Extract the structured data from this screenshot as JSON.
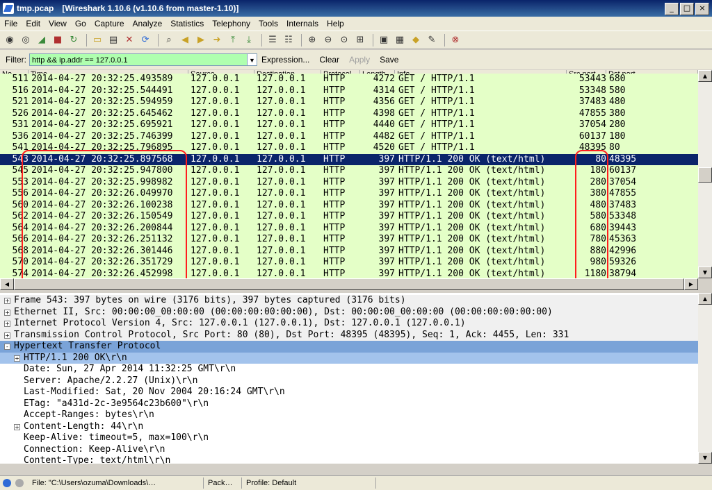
{
  "window": {
    "file": "tmp.pcap",
    "title": "[Wireshark 1.10.6  (v1.10.6 from master-1.10)]"
  },
  "menu": [
    "File",
    "Edit",
    "View",
    "Go",
    "Capture",
    "Analyze",
    "Statistics",
    "Telephony",
    "Tools",
    "Internals",
    "Help"
  ],
  "toolbar_icons": [
    "interface-list-icon",
    "capture-options-icon",
    "start-capture-icon",
    "stop-capture-icon",
    "restart-capture-icon",
    "open-file-icon",
    "save-file-icon",
    "close-file-icon",
    "reload-icon",
    "find-packet-icon",
    "go-back-icon",
    "go-forward-icon",
    "go-to-packet-icon",
    "go-first-icon",
    "go-last-icon",
    "colorize-icon",
    "autoscroll-icon",
    "zoom-in-icon",
    "zoom-out-icon",
    "normal-size-icon",
    "resize-columns-icon",
    "capture-filters-icon",
    "display-filters-icon",
    "coloring-rules-icon",
    "preferences-icon",
    "help-icon"
  ],
  "filter": {
    "label": "Filter:",
    "value": "http && ip.addr == 127.0.0.1",
    "expression": "Expression...",
    "clear": "Clear",
    "apply": "Apply",
    "save": "Save"
  },
  "columns": [
    "No.",
    "Time",
    "Source",
    "Destination",
    "Protocol",
    "Length",
    "Info",
    "Src port",
    "Dst port"
  ],
  "packets": [
    {
      "no": "511",
      "time": "2014-04-27 20:32:25.493589",
      "src": "127.0.0.1",
      "dst": "127.0.0.1",
      "proto": "HTTP",
      "len": "4272",
      "info": "GET / HTTP/1.1",
      "sport": "53443",
      "dport": "680"
    },
    {
      "no": "516",
      "time": "2014-04-27 20:32:25.544491",
      "src": "127.0.0.1",
      "dst": "127.0.0.1",
      "proto": "HTTP",
      "len": "4314",
      "info": "GET / HTTP/1.1",
      "sport": "53348",
      "dport": "580"
    },
    {
      "no": "521",
      "time": "2014-04-27 20:32:25.594959",
      "src": "127.0.0.1",
      "dst": "127.0.0.1",
      "proto": "HTTP",
      "len": "4356",
      "info": "GET / HTTP/1.1",
      "sport": "37483",
      "dport": "480"
    },
    {
      "no": "526",
      "time": "2014-04-27 20:32:25.645462",
      "src": "127.0.0.1",
      "dst": "127.0.0.1",
      "proto": "HTTP",
      "len": "4398",
      "info": "GET / HTTP/1.1",
      "sport": "47855",
      "dport": "380"
    },
    {
      "no": "531",
      "time": "2014-04-27 20:32:25.695921",
      "src": "127.0.0.1",
      "dst": "127.0.0.1",
      "proto": "HTTP",
      "len": "4440",
      "info": "GET / HTTP/1.1",
      "sport": "37054",
      "dport": "280"
    },
    {
      "no": "536",
      "time": "2014-04-27 20:32:25.746399",
      "src": "127.0.0.1",
      "dst": "127.0.0.1",
      "proto": "HTTP",
      "len": "4482",
      "info": "GET / HTTP/1.1",
      "sport": "60137",
      "dport": "180"
    },
    {
      "no": "541",
      "time": "2014-04-27 20:32:25.796895",
      "src": "127.0.0.1",
      "dst": "127.0.0.1",
      "proto": "HTTP",
      "len": "4520",
      "info": "GET / HTTP/1.1",
      "sport": "48395",
      "dport": "80"
    },
    {
      "no": "543",
      "time": "2014-04-27 20:32:25.897568",
      "src": "127.0.0.1",
      "dst": "127.0.0.1",
      "proto": "HTTP",
      "len": "397",
      "info": "HTTP/1.1 200 OK  (text/html)",
      "sport": "80",
      "dport": "48395"
    },
    {
      "no": "545",
      "time": "2014-04-27 20:32:25.947800",
      "src": "127.0.0.1",
      "dst": "127.0.0.1",
      "proto": "HTTP",
      "len": "397",
      "info": "HTTP/1.1 200 OK  (text/html)",
      "sport": "180",
      "dport": "60137"
    },
    {
      "no": "553",
      "time": "2014-04-27 20:32:25.998982",
      "src": "127.0.0.1",
      "dst": "127.0.0.1",
      "proto": "HTTP",
      "len": "397",
      "info": "HTTP/1.1 200 OK  (text/html)",
      "sport": "280",
      "dport": "37054"
    },
    {
      "no": "556",
      "time": "2014-04-27 20:32:26.049970",
      "src": "127.0.0.1",
      "dst": "127.0.0.1",
      "proto": "HTTP",
      "len": "397",
      "info": "HTTP/1.1 200 OK  (text/html)",
      "sport": "380",
      "dport": "47855"
    },
    {
      "no": "560",
      "time": "2014-04-27 20:32:26.100238",
      "src": "127.0.0.1",
      "dst": "127.0.0.1",
      "proto": "HTTP",
      "len": "397",
      "info": "HTTP/1.1 200 OK  (text/html)",
      "sport": "480",
      "dport": "37483"
    },
    {
      "no": "562",
      "time": "2014-04-27 20:32:26.150549",
      "src": "127.0.0.1",
      "dst": "127.0.0.1",
      "proto": "HTTP",
      "len": "397",
      "info": "HTTP/1.1 200 OK  (text/html)",
      "sport": "580",
      "dport": "53348"
    },
    {
      "no": "564",
      "time": "2014-04-27 20:32:26.200844",
      "src": "127.0.0.1",
      "dst": "127.0.0.1",
      "proto": "HTTP",
      "len": "397",
      "info": "HTTP/1.1 200 OK  (text/html)",
      "sport": "680",
      "dport": "39443"
    },
    {
      "no": "566",
      "time": "2014-04-27 20:32:26.251132",
      "src": "127.0.0.1",
      "dst": "127.0.0.1",
      "proto": "HTTP",
      "len": "397",
      "info": "HTTP/1.1 200 OK  (text/html)",
      "sport": "780",
      "dport": "45363"
    },
    {
      "no": "568",
      "time": "2014-04-27 20:32:26.301446",
      "src": "127.0.0.1",
      "dst": "127.0.0.1",
      "proto": "HTTP",
      "len": "397",
      "info": "HTTP/1.1 200 OK  (text/html)",
      "sport": "880",
      "dport": "42996"
    },
    {
      "no": "570",
      "time": "2014-04-27 20:32:26.351729",
      "src": "127.0.0.1",
      "dst": "127.0.0.1",
      "proto": "HTTP",
      "len": "397",
      "info": "HTTP/1.1 200 OK  (text/html)",
      "sport": "980",
      "dport": "59326"
    },
    {
      "no": "574",
      "time": "2014-04-27 20:32:26.452998",
      "src": "127.0.0.1",
      "dst": "127.0.0.1",
      "proto": "HTTP",
      "len": "397",
      "info": "HTTP/1.1 200 OK  (text/html)",
      "sport": "1180",
      "dport": "38794"
    }
  ],
  "selected_packet": "543",
  "details": [
    {
      "text": "Frame 543: 397 bytes on wire (3176 bits), 397 bytes captured (3176 bits)",
      "indent": 0,
      "expander": "+"
    },
    {
      "text": "Ethernet II, Src: 00:00:00_00:00:00 (00:00:00:00:00:00), Dst: 00:00:00_00:00:00 (00:00:00:00:00:00)",
      "indent": 0,
      "expander": "+"
    },
    {
      "text": "Internet Protocol Version 4, Src: 127.0.0.1 (127.0.0.1), Dst: 127.0.0.1 (127.0.0.1)",
      "indent": 0,
      "expander": "+"
    },
    {
      "text": "Transmission Control Protocol, Src Port: 80 (80), Dst Port: 48395 (48395), Seq: 1, Ack: 4455, Len: 331",
      "indent": 0,
      "expander": "+"
    },
    {
      "text": "Hypertext Transfer Protocol",
      "indent": 0,
      "expander": "-"
    },
    {
      "text": "HTTP/1.1 200 OK\\r\\n",
      "indent": 1,
      "expander": "+"
    },
    {
      "text": "Date: Sun, 27 Apr 2014 11:32:25 GMT\\r\\n",
      "indent": 1,
      "expander": ""
    },
    {
      "text": "Server: Apache/2.2.27 (Unix)\\r\\n",
      "indent": 1,
      "expander": ""
    },
    {
      "text": "Last-Modified: Sat, 20 Nov 2004 20:16:24 GMT\\r\\n",
      "indent": 1,
      "expander": ""
    },
    {
      "text": "ETag: \"a431d-2c-3e9564c23b600\"\\r\\n",
      "indent": 1,
      "expander": ""
    },
    {
      "text": "Accept-Ranges: bytes\\r\\n",
      "indent": 1,
      "expander": ""
    },
    {
      "text": "Content-Length: 44\\r\\n",
      "indent": 1,
      "expander": "+"
    },
    {
      "text": "Keep-Alive: timeout=5, max=100\\r\\n",
      "indent": 1,
      "expander": ""
    },
    {
      "text": "Connection: Keep-Alive\\r\\n",
      "indent": 1,
      "expander": ""
    },
    {
      "text": "Content-Type: text/html\\r\\n",
      "indent": 1,
      "expander": ""
    }
  ],
  "status": {
    "file": "File: \"C:\\Users\\ozuma\\Downloads\\…",
    "packets": "Pack…",
    "profile": "Profile: Default"
  },
  "colors": {
    "row_green": "#e4ffc7",
    "selected_row": "#0a246a",
    "highlight": "#ff1e1e",
    "filter_ok": "#afffaf",
    "http_selected": "#7aa3d8"
  }
}
